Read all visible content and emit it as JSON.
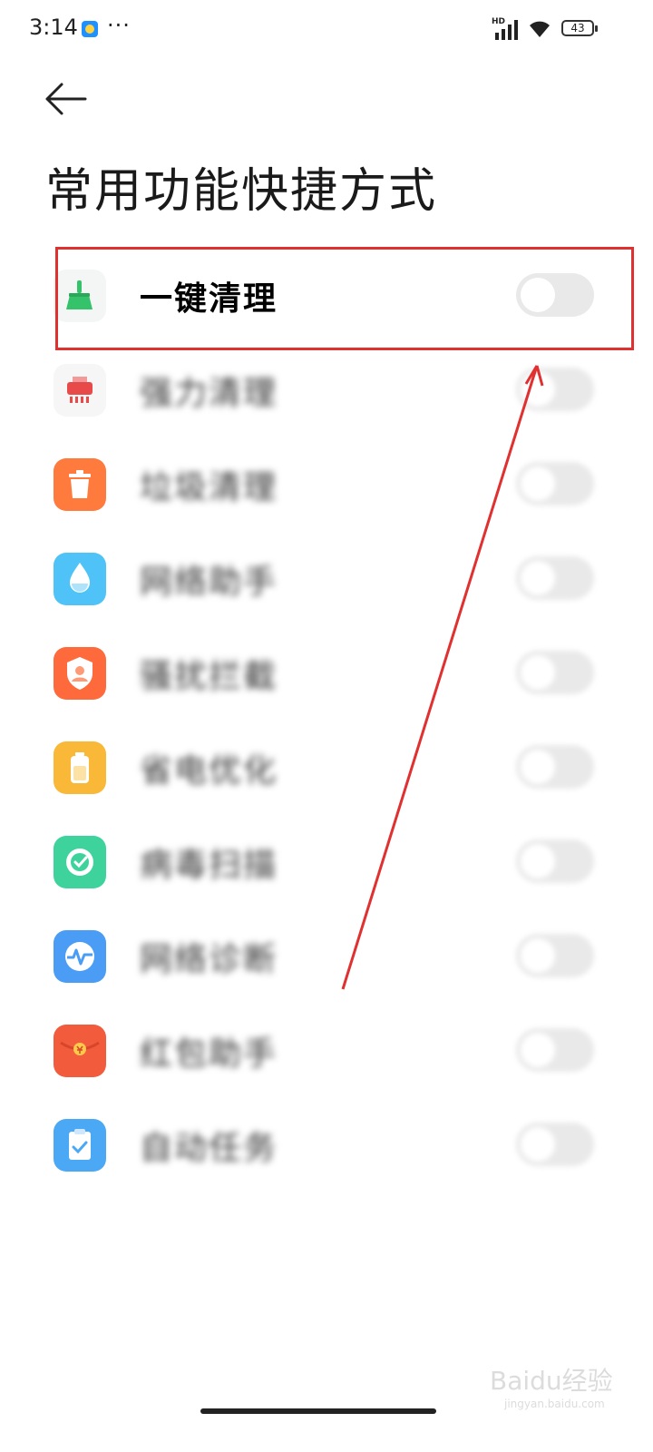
{
  "status_bar": {
    "time": "3:14",
    "dots": "···",
    "hd": "HD",
    "battery": "43"
  },
  "page": {
    "title": "常用功能快捷方式"
  },
  "items": [
    {
      "label": "一键清理",
      "icon": "broom-icon",
      "color": "#34c26a",
      "highlighted": true
    },
    {
      "label": "强力清理",
      "icon": "shredder-icon",
      "color": "#e84a4a"
    },
    {
      "label": "垃圾清理",
      "icon": "trash-icon",
      "color": "#ff7a3d"
    },
    {
      "label": "网络助手",
      "icon": "water-drop-icon",
      "color": "#4fc3f7"
    },
    {
      "label": "骚扰拦截",
      "icon": "shield-user-icon",
      "color": "#ff6a3d"
    },
    {
      "label": "省电优化",
      "icon": "battery-icon",
      "color": "#f9b838"
    },
    {
      "label": "病毒扫描",
      "icon": "scan-icon",
      "color": "#3ed39c"
    },
    {
      "label": "网络诊断",
      "icon": "pulse-icon",
      "color": "#4a9cf5"
    },
    {
      "label": "红包助手",
      "icon": "red-packet-icon",
      "color": "#f25c3c"
    },
    {
      "label": "自动任务",
      "icon": "clipboard-check-icon",
      "color": "#4aa8f5"
    }
  ],
  "watermark": {
    "brand": "Baidu经验",
    "url": "jingyan.baidu.com"
  }
}
